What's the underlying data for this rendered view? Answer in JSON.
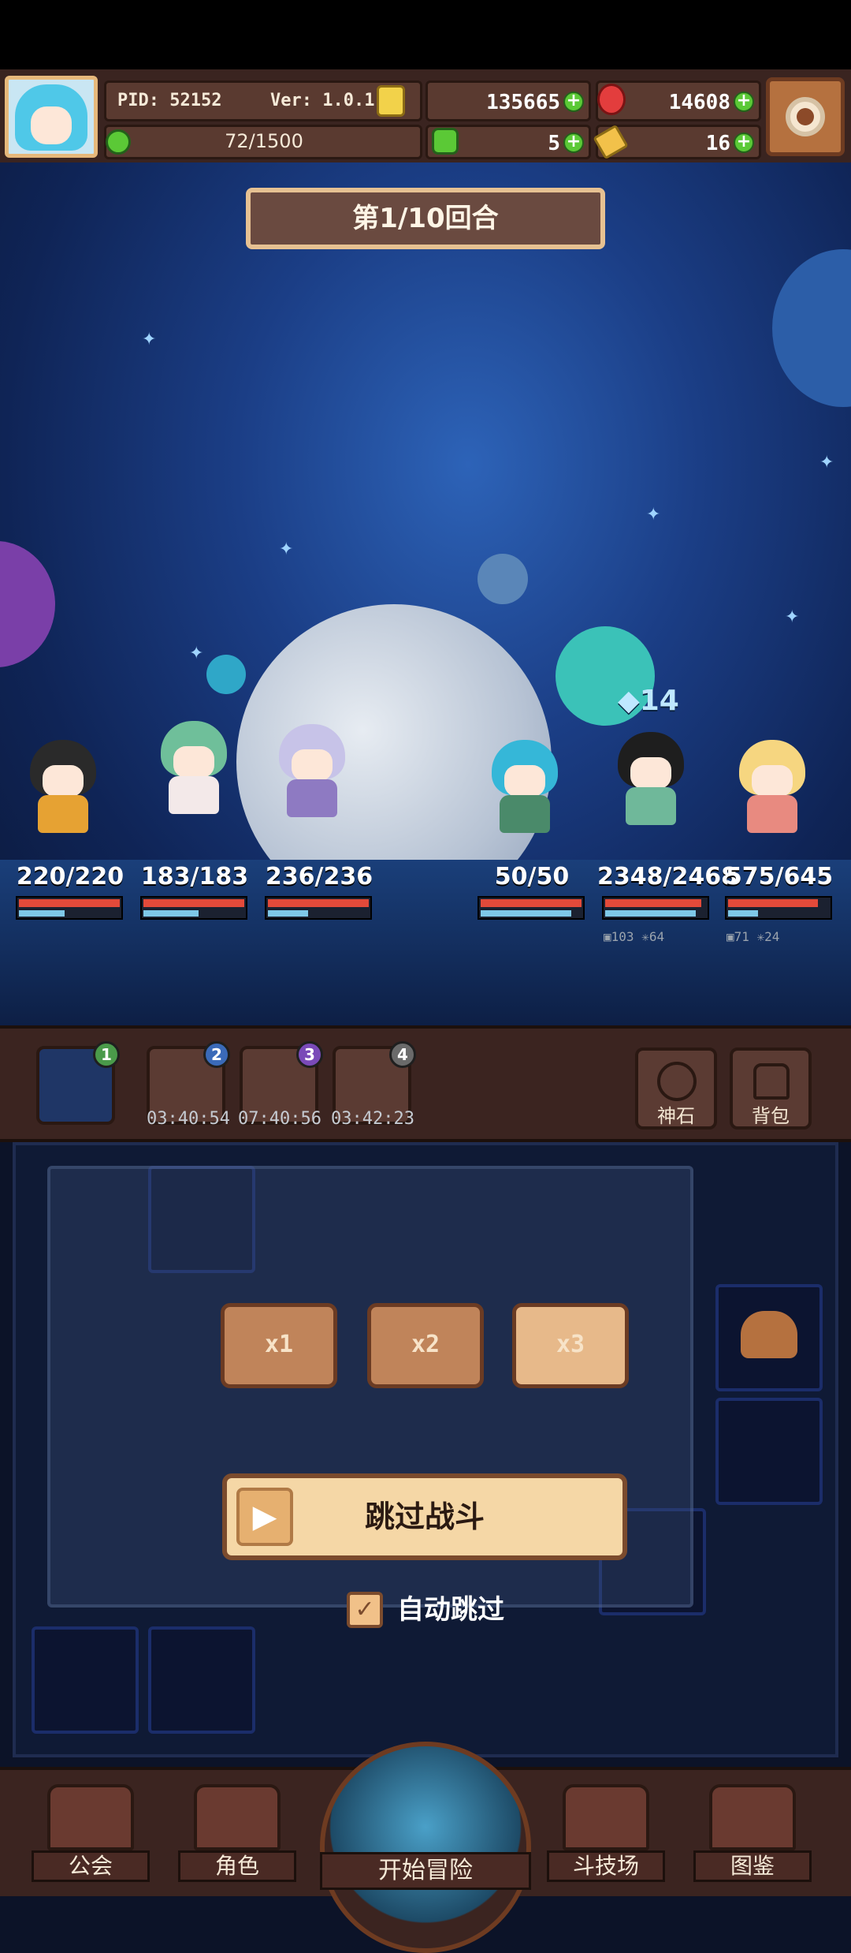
{
  "hud": {
    "pid_label": "PID: 52152",
    "version": "Ver: 1.0.1.7",
    "exp": "72/1500",
    "gold": "135665",
    "ruby": "14608",
    "clover": "5",
    "key": "16"
  },
  "battle": {
    "round": "第1/10回合",
    "allies": [
      {
        "hp": "220/220",
        "hp_frac": 1.0,
        "mp_frac": 0.45
      },
      {
        "hp": "183/183",
        "hp_frac": 1.0,
        "mp_frac": 0.55
      },
      {
        "hp": "236/236",
        "hp_frac": 1.0,
        "mp_frac": 0.4
      }
    ],
    "enemies": [
      {
        "hp": "50/50",
        "hp_frac": 1.0,
        "mp_frac": 0.9
      },
      {
        "hp": "2348/2468",
        "hp_frac": 0.95,
        "mp_frac": 0.9,
        "stat_a": "103",
        "stat_b": "64"
      },
      {
        "hp": "575/645",
        "hp_frac": 0.89,
        "mp_frac": 0.3,
        "stat_a": "71",
        "stat_b": "24"
      }
    ],
    "buff_count": "14"
  },
  "queue": {
    "slots": [
      {
        "badge": "1",
        "timer": ""
      },
      {
        "badge": "2",
        "timer": "03:40:54"
      },
      {
        "badge": "3",
        "timer": "07:40:56"
      },
      {
        "badge": "4",
        "timer": "03:42:23"
      }
    ],
    "god_stone": "神石",
    "backpack": "背包"
  },
  "controls": {
    "speeds": [
      "x1",
      "x2",
      "x3"
    ],
    "active_speed_index": 2,
    "skip_label": "跳过战斗",
    "auto_skip_label": "自动跳过",
    "auto_skip_checked": true
  },
  "nav": {
    "guild": "公会",
    "character": "角色",
    "adventure": "开始冒险",
    "arena": "斗技场",
    "codex": "图鉴"
  }
}
